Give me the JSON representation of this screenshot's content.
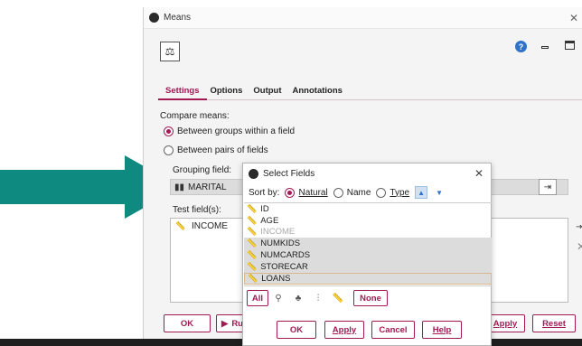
{
  "window": {
    "title": "Means"
  },
  "tabs": [
    {
      "label": "Settings",
      "active": true
    },
    {
      "label": "Options",
      "active": false
    },
    {
      "label": "Output",
      "active": false
    },
    {
      "label": "Annotations",
      "active": false
    }
  ],
  "settings": {
    "compare_label": "Compare means:",
    "radio_groups": {
      "label": "Between groups within a field",
      "selected": true
    },
    "radio_pairs": {
      "label": "Between pairs of fields",
      "selected": false
    },
    "grouping_label": "Grouping field:",
    "grouping_value": "MARITAL",
    "test_label": "Test field(s):",
    "test_fields": [
      "INCOME"
    ]
  },
  "bottom_buttons": {
    "ok": "OK",
    "run": "Ru",
    "apply": "Apply",
    "reset": "Reset"
  },
  "dialog": {
    "title": "Select Fields",
    "sort_label": "Sort by:",
    "sort_options": [
      {
        "label": "Natural",
        "selected": true
      },
      {
        "label": "Name",
        "selected": false
      },
      {
        "label": "Type",
        "selected": false
      }
    ],
    "fields": [
      {
        "name": "ID",
        "state": "normal"
      },
      {
        "name": "AGE",
        "state": "normal"
      },
      {
        "name": "INCOME",
        "state": "disabled"
      },
      {
        "name": "NUMKIDS",
        "state": "selected"
      },
      {
        "name": "NUMCARDS",
        "state": "selected"
      },
      {
        "name": "STORECAR",
        "state": "selected"
      },
      {
        "name": "LOANS",
        "state": "selected-focus"
      }
    ],
    "all_label": "All",
    "none_label": "None",
    "ok": "OK",
    "apply": "Apply",
    "cancel": "Cancel",
    "help": "Help"
  },
  "colors": {
    "accent": "#a11a54",
    "arrow": "#0e8a80",
    "selection": "#dcdcdc"
  }
}
